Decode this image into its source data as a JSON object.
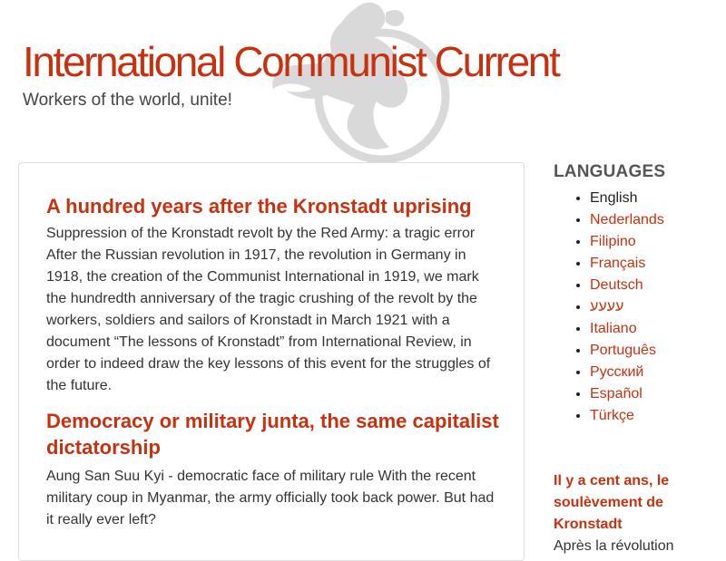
{
  "header": {
    "site_title": "International Communist Current",
    "slogan": "Workers of the world, unite!",
    "logo_icon": "icc-logo-emblem-icon"
  },
  "main": {
    "articles": [
      {
        "title": "A hundred years after the Kronstadt uprising",
        "summary": "Suppression of the Kronstadt revolt by the Red Army: a tragic error After the Russian revolution in 1917, the revolution in Germany in 1918, the creation of the Communist International in 1919, we mark the hundredth anniversary of the tragic crushing of the revolt by the workers, soldiers and sailors of Kronstadt in March 1921 with a document “The lessons of Kronstadt” from International Review, in order to indeed draw the key lessons of this event for the struggles of the future."
      },
      {
        "title": "Democracy or military junta, the same capitalist dictatorship",
        "summary": "Aung San Suu Kyi - democratic face of military rule With the recent military coup in Myanmar, the army officially took back power. But had it really ever left?"
      }
    ]
  },
  "sidebar": {
    "languages_title": "LANGUAGES",
    "languages": [
      {
        "label": "English",
        "current": true
      },
      {
        "label": "Nederlands",
        "current": false
      },
      {
        "label": "Filipino",
        "current": false
      },
      {
        "label": "Français",
        "current": false
      },
      {
        "label": "Deutsch",
        "current": false
      },
      {
        "label": "ﬠﬠﬠﬠ",
        "current": false
      },
      {
        "label": "Italiano",
        "current": false
      },
      {
        "label": "Português",
        "current": false
      },
      {
        "label": "Русский",
        "current": false
      },
      {
        "label": "Español",
        "current": false
      },
      {
        "label": "Türkçe",
        "current": false
      }
    ],
    "side_article": {
      "title": "Il y a cent ans, le soulèvement de Kronstadt",
      "summary_fragment": "Après la révolution"
    }
  },
  "colors": {
    "accent": "#c8310f",
    "text": "#333333",
    "border": "#dedede"
  }
}
